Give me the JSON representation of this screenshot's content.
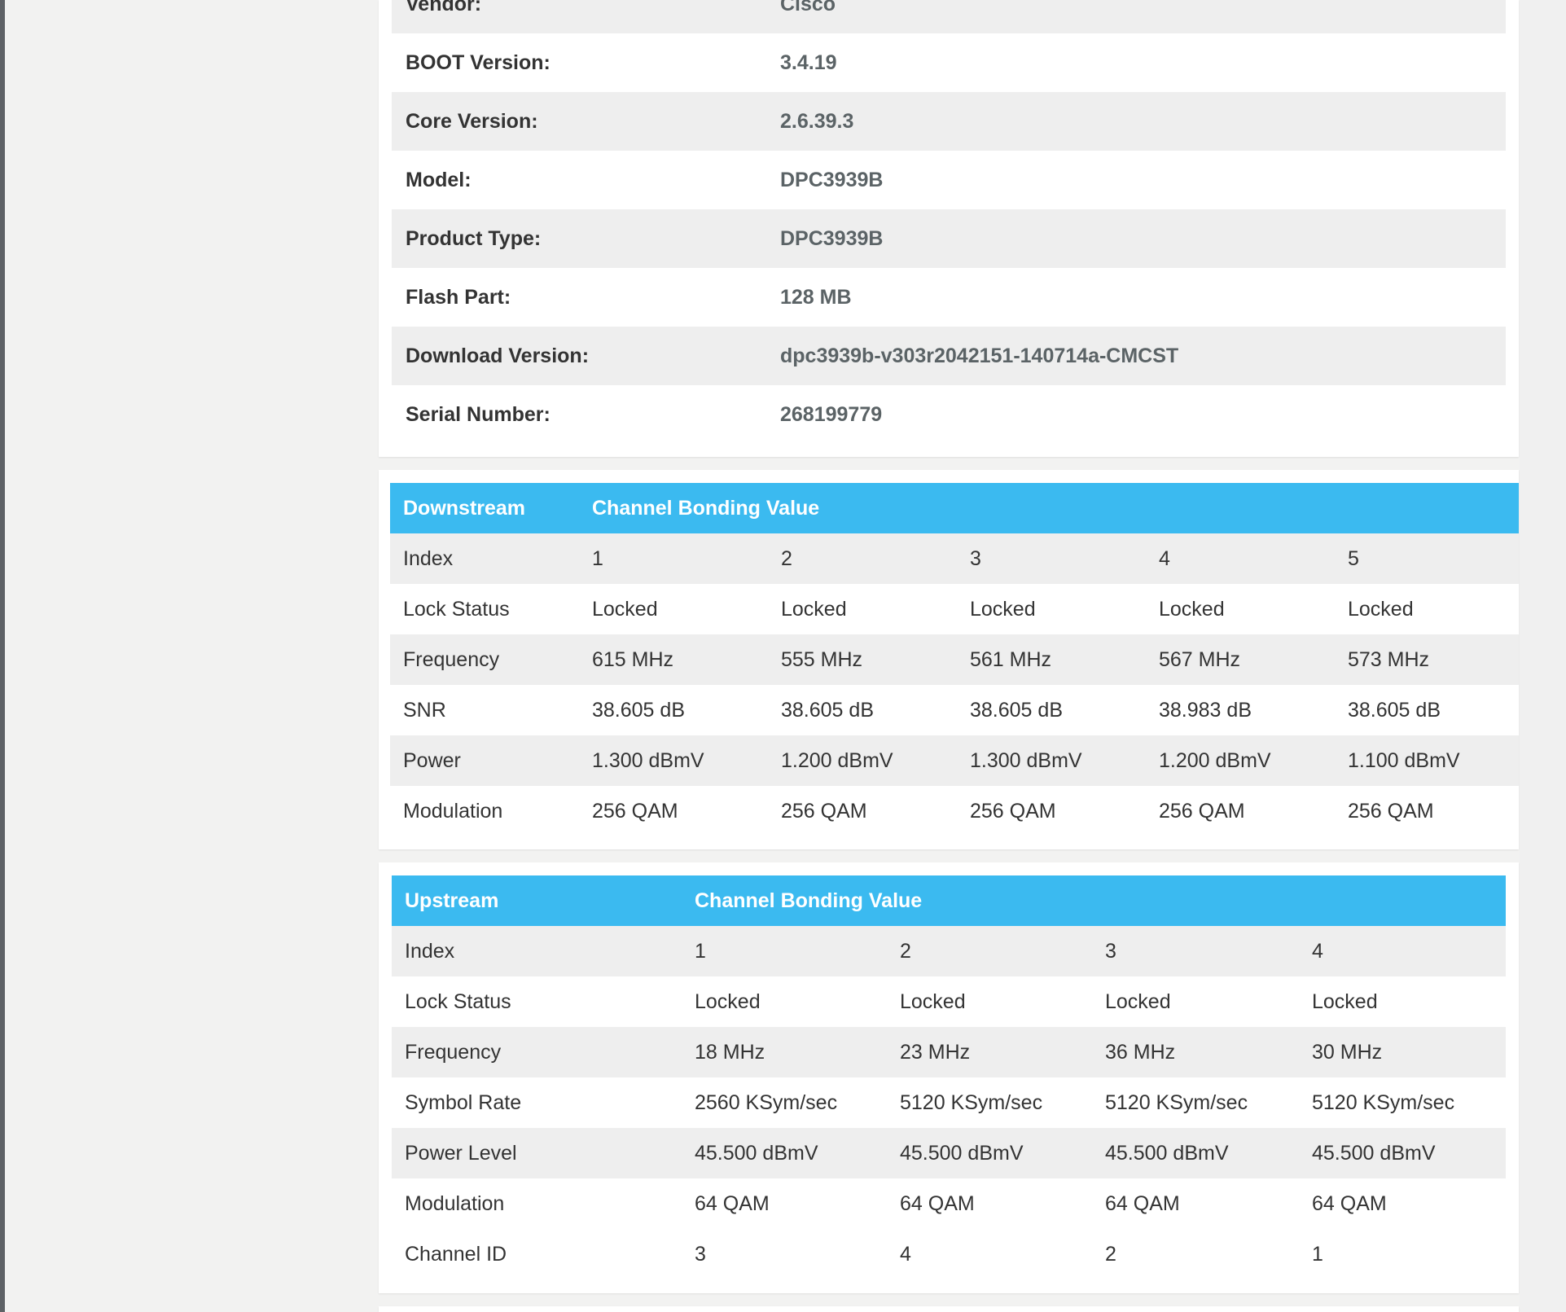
{
  "device_info": [
    {
      "label": "Vendor:",
      "value": "Cisco"
    },
    {
      "label": "BOOT Version:",
      "value": "3.4.19"
    },
    {
      "label": "Core Version:",
      "value": "2.6.39.3"
    },
    {
      "label": "Model:",
      "value": "DPC3939B"
    },
    {
      "label": "Product Type:",
      "value": "DPC3939B"
    },
    {
      "label": "Flash Part:",
      "value": "128 MB"
    },
    {
      "label": "Download Version:",
      "value": "dpc3939b-v303r2042151-140714a-CMCST"
    },
    {
      "label": "Serial Number:",
      "value": "268199779"
    }
  ],
  "downstream": {
    "title": "Downstream",
    "subtitle": "Channel Bonding Value",
    "rows": [
      {
        "label": "Index",
        "values": [
          "1",
          "2",
          "3",
          "4",
          "5"
        ]
      },
      {
        "label": "Lock Status",
        "values": [
          "Locked",
          "Locked",
          "Locked",
          "Locked",
          "Locked"
        ]
      },
      {
        "label": "Frequency",
        "values": [
          "615 MHz",
          "555 MHz",
          "561 MHz",
          "567 MHz",
          "573 MHz"
        ]
      },
      {
        "label": "SNR",
        "values": [
          "38.605 dB",
          "38.605 dB",
          "38.605 dB",
          "38.983 dB",
          "38.605 dB"
        ]
      },
      {
        "label": "Power",
        "values": [
          "1.300 dBmV",
          "1.200 dBmV",
          "1.300 dBmV",
          "1.200 dBmV",
          "1.100 dBmV"
        ]
      },
      {
        "label": "Modulation",
        "values": [
          "256 QAM",
          "256 QAM",
          "256 QAM",
          "256 QAM",
          "256 QAM"
        ]
      }
    ]
  },
  "upstream": {
    "title": "Upstream",
    "subtitle": "Channel Bonding Value",
    "rows": [
      {
        "label": "Index",
        "values": [
          "1",
          "2",
          "3",
          "4"
        ]
      },
      {
        "label": "Lock Status",
        "values": [
          "Locked",
          "Locked",
          "Locked",
          "Locked"
        ]
      },
      {
        "label": "Frequency",
        "values": [
          "18 MHz",
          "23 MHz",
          "36 MHz",
          "30 MHz"
        ]
      },
      {
        "label": "Symbol Rate",
        "values": [
          "2560 KSym/sec",
          "5120 KSym/sec",
          "5120 KSym/sec",
          "5120 KSym/sec"
        ]
      },
      {
        "label": "Power Level",
        "values": [
          "45.500 dBmV",
          "45.500 dBmV",
          "45.500 dBmV",
          "45.500 dBmV"
        ]
      },
      {
        "label": "Modulation",
        "values": [
          "64 QAM",
          "64 QAM",
          "64 QAM",
          "64 QAM"
        ]
      },
      {
        "label": "Channel ID",
        "values": [
          "3",
          "4",
          "2",
          "1"
        ]
      }
    ]
  },
  "colors": {
    "header_bg": "#3bbaf0",
    "row_shade": "#eeeeee",
    "page_bg": "#f2f2f1"
  }
}
